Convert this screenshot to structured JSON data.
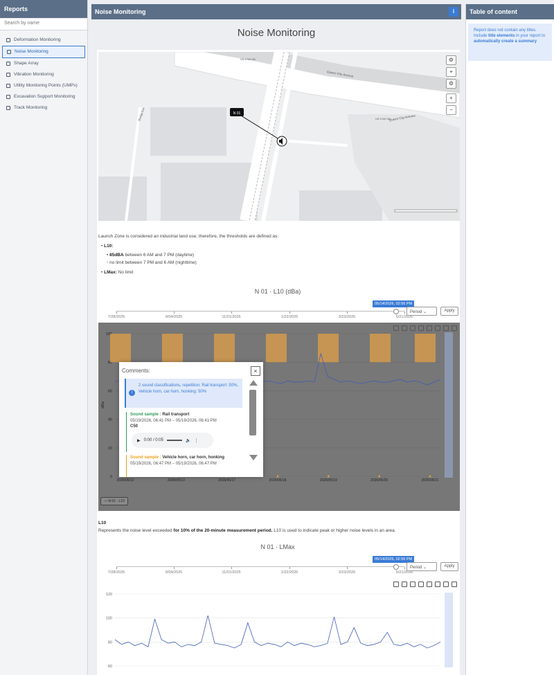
{
  "sidebar": {
    "title": "Reports",
    "search_placeholder": "Search by name",
    "items": [
      {
        "label": "Deformation Monitoring"
      },
      {
        "label": "Noise Monitoring"
      },
      {
        "label": "Shape Array"
      },
      {
        "label": "Vibration Monitoring"
      },
      {
        "label": "Utility Monitoring Points (UMPs)"
      },
      {
        "label": "Excavation Support Monitoring"
      },
      {
        "label": "Track Monitoring"
      }
    ]
  },
  "header": {
    "title": "Noise Monitoring",
    "info_icon": "i"
  },
  "page_title": "Noise Monitoring",
  "map": {
    "marker_label": "N 01",
    "street_1": "Queen City Avenue",
    "street_2": "Queen City Avenue",
    "street_3": "Brokgs Ave",
    "highway_1": "US 3 NH 3A",
    "highway_2": "US 3 NH 3A"
  },
  "description": {
    "intro": "Launch Zone is considered an industrial land use; therefore, the thresholds are defined as:",
    "l10_label": "L10:",
    "l10_day_value": "85dBA",
    "l10_day_text": " between 6 AM and 7 PM (daytime)",
    "l10_night_text": "no limit between 7 PM and 6 AM (nighttime)",
    "lmax_label": "LMax:",
    "lmax_text": " No limit"
  },
  "chart1": {
    "title": "N 01 · L10 (dBa)",
    "date_badge": "05/14/2026, 02:56 PM",
    "period_label": "Period",
    "apply_label": "Apply",
    "slider_labels": [
      "7/28/2025",
      "9/04/2025",
      "11/01/2025",
      "1/22/2026",
      "3/23/2026",
      "5/21/2026"
    ],
    "legend": "N 01 · L10"
  },
  "comments": {
    "title": "Comments:",
    "close": "×",
    "info": "2 sound classifications, repetition: Rail transport: 50%, Vehicle horn, car horn, honking: 50%",
    "sample1_label": "Sound sample :",
    "sample1_value": "Rail transport",
    "sample1_time": "05/19/2026, 06:41 PM – 05/19/2026, 06:41 PM",
    "sample1_code": "C50",
    "audio_time": "0:00 / 0:05",
    "sample2_label": "Sound sample :",
    "sample2_value": "Vehicle horn, car horn, honking",
    "sample2_time": "05/19/2026, 06:47 PM – 05/19/2026, 06:47 PM"
  },
  "l10_section": {
    "heading": "L10",
    "text_a": "Represents the noise level exceeded ",
    "text_b": "for 10% of the 20-minute measurement period.",
    "text_c": " L10 is used to indicate peak or higher noise levels in an area."
  },
  "chart2": {
    "title": "N 01 · LMax",
    "date_badge": "05/14/2026, 02:56 PM",
    "period_label": "Period",
    "apply_label": "Apply",
    "slider_labels": [
      "7/28/2025",
      "9/04/2025",
      "11/01/2025",
      "1/22/2026",
      "3/23/2026",
      "5/21/2026"
    ]
  },
  "toc": {
    "title": "Table of content",
    "note_a": "Report does not contain any titles. Include ",
    "note_b": "title elements",
    "note_c": " in your report to ",
    "note_d": "automatically create a summary"
  },
  "colors": {
    "accent": "#3a7bd5",
    "header": "#5b6f88",
    "series": "#3f5cb8",
    "band": "#d39a4c",
    "sample1": "#2f9e5b",
    "sample2": "#f0a020"
  },
  "chart_data": [
    {
      "type": "line",
      "title": "N 01 · L10 (dBa)",
      "ylabel": "dBa",
      "ylim": [
        0,
        100
      ],
      "yticks": [
        0,
        20,
        40,
        60,
        80,
        100
      ],
      "xticks": [
        "2026/05/12",
        "2026/05/13",
        "2026/05/17",
        "2026/05/18",
        "2026/05/19",
        "2026/05/20",
        "2026/05/21"
      ],
      "series": [
        {
          "name": "N 01 · L10",
          "values": [
            66,
            68,
            67,
            70,
            66,
            67,
            74,
            69,
            66,
            67,
            66,
            65,
            66,
            67,
            66,
            66,
            68,
            66,
            67,
            66,
            68,
            67,
            66,
            67,
            66,
            65,
            67,
            66,
            66,
            67,
            66,
            86,
            70,
            68,
            66,
            67,
            66,
            65,
            66,
            67,
            66,
            66,
            67,
            68,
            66,
            67,
            66,
            64,
            66,
            68
          ]
        }
      ],
      "threshold_bands": 7
    },
    {
      "type": "line",
      "title": "N 01 · LMax",
      "ylim": [
        60,
        120
      ],
      "yticks": [
        60,
        80,
        100,
        120
      ],
      "series": [
        {
          "values": [
            82,
            78,
            80,
            77,
            79,
            76,
            99,
            82,
            79,
            80,
            76,
            78,
            77,
            80,
            102,
            79,
            78,
            77,
            75,
            78,
            96,
            80,
            77,
            79,
            78,
            76,
            80,
            77,
            79,
            78,
            76,
            77,
            79,
            101,
            78,
            80,
            92,
            79,
            77,
            78,
            80,
            88,
            78,
            77,
            79,
            76,
            78,
            75,
            77,
            80
          ]
        }
      ]
    }
  ]
}
